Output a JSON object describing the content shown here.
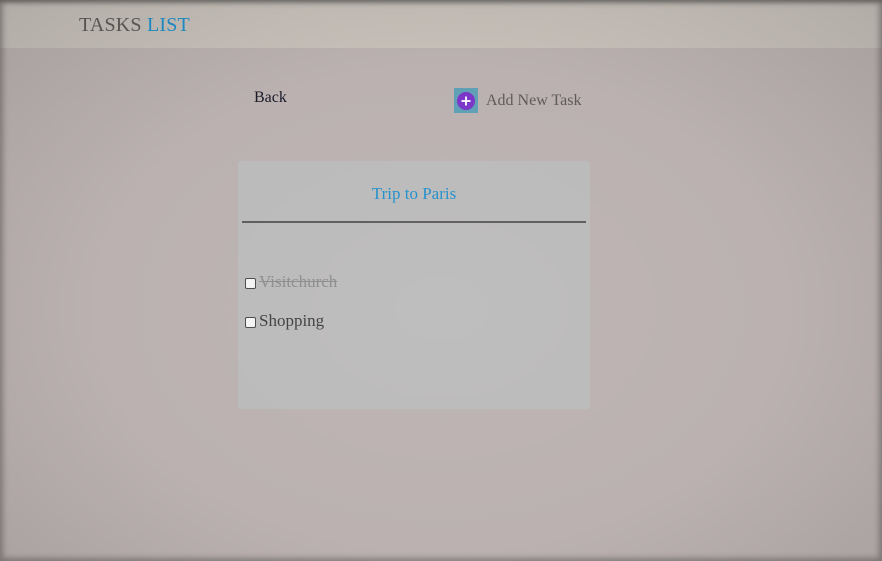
{
  "header": {
    "title_main": "TASKS",
    "title_accent": "LIST"
  },
  "toolbar": {
    "back_label": "Back",
    "add_label": "Add New Task",
    "add_icon": "plus-circle-icon"
  },
  "list": {
    "title": "Trip to Paris",
    "tasks": [
      {
        "label": "Visitchurch",
        "done": true,
        "checked": false
      },
      {
        "label": "Shopping",
        "done": false,
        "checked": false
      }
    ]
  },
  "colors": {
    "accent": "#1f8fcb",
    "background": "#bab1b0",
    "header": "#c6c0b9",
    "card": "#bbbaba",
    "add_icon_bg": "#5fa0b6",
    "add_icon_circle": "#7b36c8"
  }
}
